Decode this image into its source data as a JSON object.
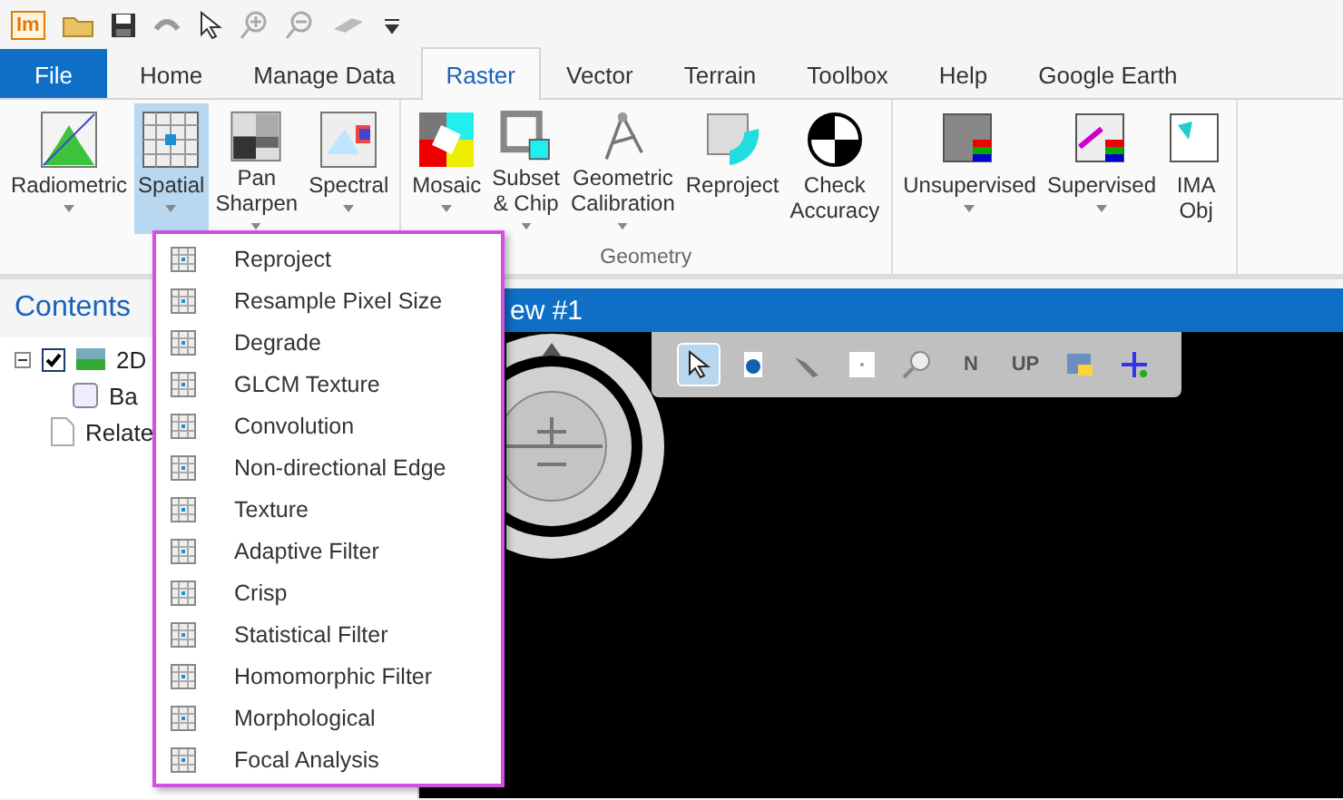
{
  "quick_access": {
    "logo": "Im"
  },
  "tabs": [
    {
      "label": "File",
      "kind": "file",
      "selected": false
    },
    {
      "label": "Home",
      "kind": "tab",
      "selected": false
    },
    {
      "label": "Manage Data",
      "kind": "tab",
      "selected": false
    },
    {
      "label": "Raster",
      "kind": "tab",
      "selected": true
    },
    {
      "label": "Vector",
      "kind": "tab",
      "selected": false
    },
    {
      "label": "Terrain",
      "kind": "tab",
      "selected": false
    },
    {
      "label": "Toolbox",
      "kind": "tab",
      "selected": false
    },
    {
      "label": "Help",
      "kind": "tab",
      "selected": false
    },
    {
      "label": "Google Earth",
      "kind": "tab",
      "selected": false
    }
  ],
  "ribbon": {
    "groups": [
      {
        "buttons": [
          {
            "lines": [
              "Radiometric"
            ],
            "dropdown": true,
            "selected": false
          },
          {
            "lines": [
              "Spatial"
            ],
            "dropdown": true,
            "selected": true
          },
          {
            "lines": [
              "Pan",
              "Sharpen"
            ],
            "dropdown": true,
            "selected": false
          },
          {
            "lines": [
              "Spectral"
            ],
            "dropdown": true,
            "selected": false
          }
        ]
      },
      {
        "label": "Geometry",
        "buttons": [
          {
            "lines": [
              "Mosaic"
            ],
            "dropdown": true,
            "selected": false
          },
          {
            "lines": [
              "Subset",
              "& Chip"
            ],
            "dropdown": true,
            "selected": false
          },
          {
            "lines": [
              "Geometric",
              "Calibration"
            ],
            "dropdown": true,
            "selected": false
          },
          {
            "lines": [
              "Reproject"
            ],
            "dropdown": false,
            "selected": false
          },
          {
            "lines": [
              "Check",
              "Accuracy"
            ],
            "dropdown": false,
            "selected": false
          }
        ]
      },
      {
        "buttons": [
          {
            "lines": [
              "Unsupervised"
            ],
            "dropdown": true,
            "selected": false
          },
          {
            "lines": [
              "Supervised"
            ],
            "dropdown": true,
            "selected": false
          },
          {
            "lines": [
              "IMA",
              "Obj"
            ],
            "dropdown": false,
            "selected": false
          }
        ]
      }
    ]
  },
  "contents": {
    "title": "Contents",
    "tree": [
      {
        "label": "2D",
        "checked": true,
        "expanded": true,
        "children": [
          {
            "label": "Ba",
            "checked": false
          }
        ]
      },
      {
        "label": "Relate"
      }
    ]
  },
  "view": {
    "title": "ew #1",
    "tools": [
      {
        "selected": true
      },
      {
        "selected": false
      },
      {
        "selected": false
      },
      {
        "selected": false
      },
      {
        "selected": false
      },
      {
        "label": "N",
        "selected": false
      },
      {
        "label": "UP",
        "selected": false
      },
      {
        "selected": false
      },
      {
        "selected": false
      }
    ]
  },
  "spatial_menu": [
    "Reproject",
    "Resample Pixel Size",
    "Degrade",
    "GLCM Texture",
    "Convolution",
    "Non-directional Edge",
    "Texture",
    "Adaptive Filter",
    "Crisp",
    "Statistical Filter",
    "Homomorphic Filter",
    "Morphological",
    "Focal Analysis"
  ]
}
